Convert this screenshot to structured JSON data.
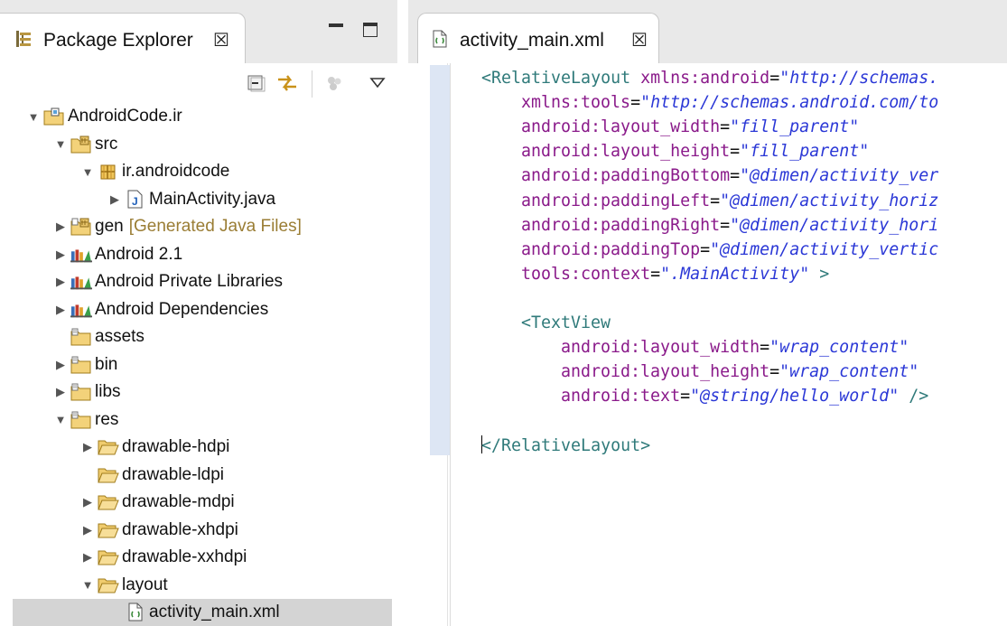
{
  "package_explorer": {
    "title": "Package Explorer",
    "close_glyph": "☒"
  },
  "tree": [
    {
      "label": "AndroidCode.ir",
      "level": 0,
      "twisty": "▼",
      "icon": "project-folder-icon"
    },
    {
      "label": "src",
      "level": 1,
      "twisty": "▼",
      "icon": "source-folder-icon"
    },
    {
      "label": "ir.androidcode",
      "level": 2,
      "twisty": "▼",
      "icon": "package-icon"
    },
    {
      "label": "MainActivity.java",
      "level": 3,
      "twisty": "▶",
      "icon": "java-file-icon"
    },
    {
      "label": "gen",
      "decorator": "[Generated Java Files]",
      "level": 1,
      "twisty": "▶",
      "icon": "generated-folder-icon"
    },
    {
      "label": "Android 2.1",
      "level": 1,
      "twisty": "▶",
      "icon": "library-icon"
    },
    {
      "label": "Android Private Libraries",
      "level": 1,
      "twisty": "▶",
      "icon": "library-icon"
    },
    {
      "label": "Android Dependencies",
      "level": 1,
      "twisty": "▶",
      "icon": "library-icon"
    },
    {
      "label": "assets",
      "level": 1,
      "twisty": "",
      "icon": "folder-icon"
    },
    {
      "label": "bin",
      "level": 1,
      "twisty": "▶",
      "icon": "folder-icon"
    },
    {
      "label": "libs",
      "level": 1,
      "twisty": "▶",
      "icon": "folder-icon"
    },
    {
      "label": "res",
      "level": 1,
      "twisty": "▼",
      "icon": "folder-icon"
    },
    {
      "label": "drawable-hdpi",
      "level": 2,
      "twisty": "▶",
      "icon": "open-folder-icon"
    },
    {
      "label": "drawable-ldpi",
      "level": 2,
      "twisty": "",
      "icon": "open-folder-icon"
    },
    {
      "label": "drawable-mdpi",
      "level": 2,
      "twisty": "▶",
      "icon": "open-folder-icon"
    },
    {
      "label": "drawable-xhdpi",
      "level": 2,
      "twisty": "▶",
      "icon": "open-folder-icon"
    },
    {
      "label": "drawable-xxhdpi",
      "level": 2,
      "twisty": "▶",
      "icon": "open-folder-icon"
    },
    {
      "label": "layout",
      "level": 2,
      "twisty": "▼",
      "icon": "open-folder-icon"
    },
    {
      "label": "activity_main.xml",
      "level": 3,
      "twisty": "",
      "icon": "xml-file-icon",
      "selected": true
    }
  ],
  "editor": {
    "tab_title": "activity_main.xml",
    "close_glyph": "☒"
  },
  "code_lines": [
    {
      "indent": 0,
      "parts": [
        [
          "tag",
          "<RelativeLayout "
        ],
        [
          "attr",
          "xmlns:android"
        ],
        [
          "eq",
          "="
        ],
        [
          "val",
          "\"http://schemas."
        ]
      ]
    },
    {
      "indent": 2,
      "parts": [
        [
          "attr",
          "xmlns:tools"
        ],
        [
          "eq",
          "="
        ],
        [
          "val",
          "\"http://schemas.android.com/to"
        ]
      ]
    },
    {
      "indent": 2,
      "parts": [
        [
          "attr",
          "android:layout_width"
        ],
        [
          "eq",
          "="
        ],
        [
          "val",
          "\"fill_parent\""
        ]
      ]
    },
    {
      "indent": 2,
      "parts": [
        [
          "attr",
          "android:layout_height"
        ],
        [
          "eq",
          "="
        ],
        [
          "val",
          "\"fill_parent\""
        ]
      ]
    },
    {
      "indent": 2,
      "parts": [
        [
          "attr",
          "android:paddingBottom"
        ],
        [
          "eq",
          "="
        ],
        [
          "val",
          "\"@dimen/activity_ver"
        ]
      ]
    },
    {
      "indent": 2,
      "parts": [
        [
          "attr",
          "android:paddingLeft"
        ],
        [
          "eq",
          "="
        ],
        [
          "val",
          "\"@dimen/activity_horiz"
        ]
      ]
    },
    {
      "indent": 2,
      "parts": [
        [
          "attr",
          "android:paddingRight"
        ],
        [
          "eq",
          "="
        ],
        [
          "val",
          "\"@dimen/activity_hori"
        ]
      ]
    },
    {
      "indent": 2,
      "parts": [
        [
          "attr",
          "android:paddingTop"
        ],
        [
          "eq",
          "="
        ],
        [
          "val",
          "\"@dimen/activity_vertic"
        ]
      ]
    },
    {
      "indent": 2,
      "parts": [
        [
          "attr",
          "tools:context"
        ],
        [
          "eq",
          "="
        ],
        [
          "val",
          "\".MainActivity\""
        ],
        [
          "punct",
          " >"
        ]
      ]
    },
    {
      "indent": 0,
      "parts": []
    },
    {
      "indent": 2,
      "parts": [
        [
          "tag",
          "<TextView"
        ]
      ]
    },
    {
      "indent": 4,
      "parts": [
        [
          "attr",
          "android:layout_width"
        ],
        [
          "eq",
          "="
        ],
        [
          "val",
          "\"wrap_content\""
        ]
      ]
    },
    {
      "indent": 4,
      "parts": [
        [
          "attr",
          "android:layout_height"
        ],
        [
          "eq",
          "="
        ],
        [
          "val",
          "\"wrap_content\""
        ]
      ]
    },
    {
      "indent": 4,
      "parts": [
        [
          "attr",
          "android:text"
        ],
        [
          "eq",
          "="
        ],
        [
          "val",
          "\"@string/hello_world\""
        ],
        [
          "punct",
          " />"
        ]
      ]
    },
    {
      "indent": 0,
      "parts": []
    },
    {
      "indent": 0,
      "caret": true,
      "parts": [
        [
          "tag",
          "</RelativeLayout>"
        ]
      ]
    }
  ]
}
